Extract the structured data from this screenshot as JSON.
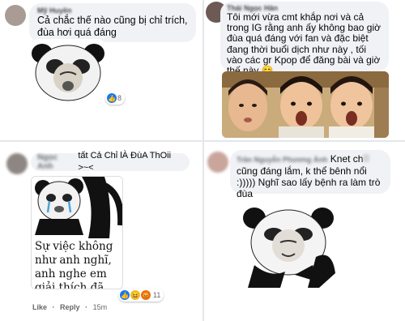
{
  "top_left": {
    "author": "Mỹ Huyền",
    "comment": "Cả chắc thế nào cũng bị chỉ trích, đùa hơi quá đáng",
    "reaction_count": "8"
  },
  "top_right": {
    "author": "Thái Ngọc Hân",
    "comment": "Tôi mới vừa cmt khắp nơi và cả trong IG rằng anh ấy không bao giờ đùa quá đáng với fan và đặc biệt đang thời buổi dịch như này , tối vào các gr Kpop để đăng bài và giờ thế này 😊"
  },
  "bottom_left": {
    "author_hidden": "Ngọc Anh",
    "comment": "tất Cả Chỉ lÀ ĐùA ThOii >~<",
    "sticker_caption": "Sự việc không như anh nghĩ, anh nghe em giải thích đã",
    "reaction_count": "11",
    "actions": {
      "like": "Like",
      "reply": "Reply",
      "time": "15m"
    }
  },
  "bottom_right": {
    "author": "Trần Nguyễn Phương Ánh",
    "comment_prefix": "Knet ch",
    "comment_rest": " cũng đáng lắm, k thể bênh nổi :))))) Nghĩ sao lấy bệnh ra làm trò đùa"
  },
  "colors": {
    "bubble": "#f0f2f5",
    "like_blue": "#1877f2",
    "haha_yellow": "#f7b928",
    "meta_gray": "#65676b"
  },
  "icons": [
    "like-reaction-icon",
    "haha-reaction-icon",
    "sad-reaction-icon",
    "angry-reaction-icon"
  ]
}
